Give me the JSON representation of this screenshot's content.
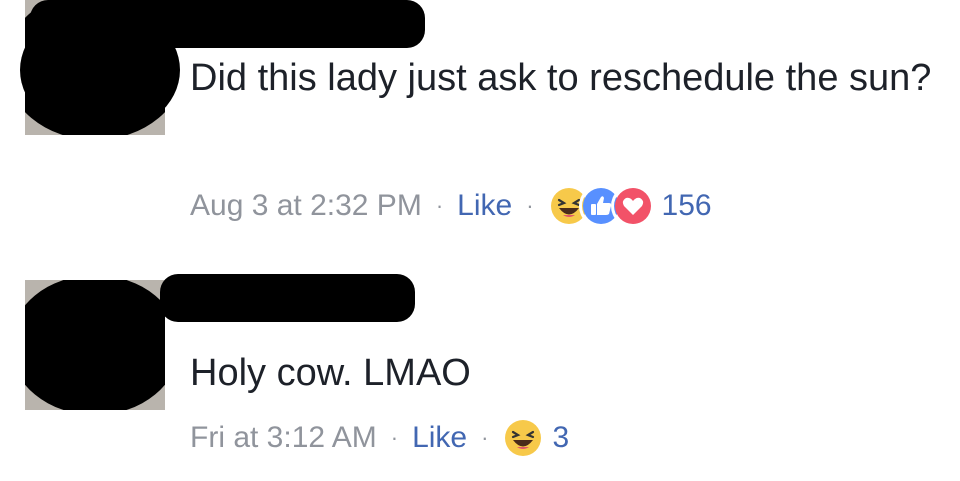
{
  "comments": [
    {
      "text": "Did this lady just ask to reschedule the sun?",
      "timestamp": "Aug 3 at 2:32 PM",
      "like_label": "Like",
      "separator": "·",
      "reactions": [
        "haha-icon",
        "like-icon",
        "love-icon"
      ],
      "reaction_count": "156"
    },
    {
      "text": "Holy cow. LMAO",
      "timestamp": "Fri at 3:12 AM",
      "like_label": "Like",
      "separator": "·",
      "reactions": [
        "haha-icon"
      ],
      "reaction_count": "3"
    }
  ],
  "colors": {
    "link": "#4267b2",
    "meta": "#90949c",
    "text": "#1d2129",
    "haha": "#f7c94a",
    "like": "#5890ff",
    "love": "#f25268"
  }
}
